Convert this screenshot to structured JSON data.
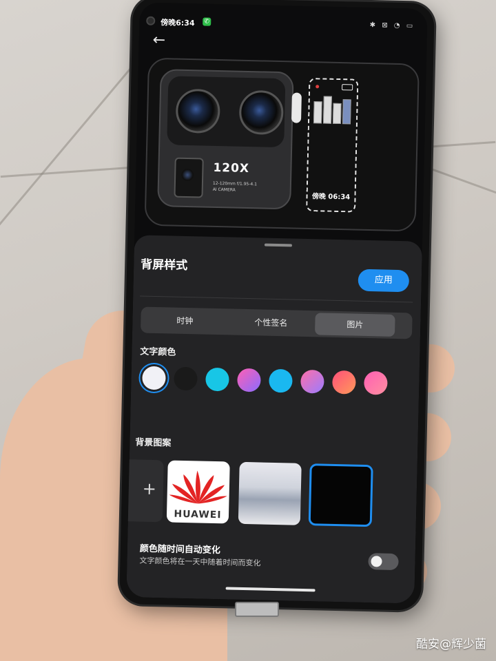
{
  "status_bar": {
    "time": "傍晚6:34",
    "icons": "✱ ⊠ ◔ ▭"
  },
  "nav": {
    "back_icon": "←"
  },
  "preview": {
    "camera_zoom": "120X",
    "camera_spec_line1": "12-120mm f/1.95-4.1",
    "camera_spec_line2": "AI CAMERA",
    "rear_screen_time": "傍晚 06:34"
  },
  "sheet": {
    "title": "背屏样式",
    "apply_label": "应用",
    "tabs": [
      {
        "label": "时钟",
        "active": false
      },
      {
        "label": "个性签名",
        "active": false
      },
      {
        "label": "图片",
        "active": true
      }
    ],
    "text_color_label": "文字颜色",
    "text_colors": [
      {
        "name": "white",
        "fill": "#f1f1f6",
        "selected": true
      },
      {
        "name": "black",
        "fill": "#1a1a1a",
        "selected": false
      },
      {
        "name": "cyan",
        "fill": "#18c6e6",
        "selected": false
      },
      {
        "name": "pink-purple",
        "fill": "linear-gradient(135deg,#ff5fb4,#8a6cff)",
        "selected": false
      },
      {
        "name": "sky-blue",
        "fill": "#1ab8f0",
        "selected": false
      },
      {
        "name": "pink-violet",
        "fill": "linear-gradient(135deg,#ff6fa8,#9a7cff)",
        "selected": false
      },
      {
        "name": "coral",
        "fill": "linear-gradient(135deg,#ff4f7a,#ff9a5a)",
        "selected": false
      },
      {
        "name": "pink-orange",
        "fill": "linear-gradient(135deg,#ff5fb4,#ff8fa0)",
        "selected": false
      }
    ],
    "background_label": "背景图案",
    "background_thumbs": [
      {
        "name": "add",
        "caption": "+",
        "selected": false
      },
      {
        "name": "huawei-logo",
        "caption": "HUAWEI",
        "selected": false
      },
      {
        "name": "store-photo",
        "caption": "",
        "selected": false
      },
      {
        "name": "black",
        "caption": "",
        "selected": true
      }
    ],
    "auto_color_title": "颜色随时间自动变化",
    "auto_color_desc": "文字颜色将在一天中随着时间而变化",
    "auto_color_on": false
  },
  "watermark": "酷安@辉少菌",
  "colors": {
    "accent": "#1f8ef0",
    "sheet_bg": "#232325",
    "screen_bg": "#0c0c0d"
  }
}
